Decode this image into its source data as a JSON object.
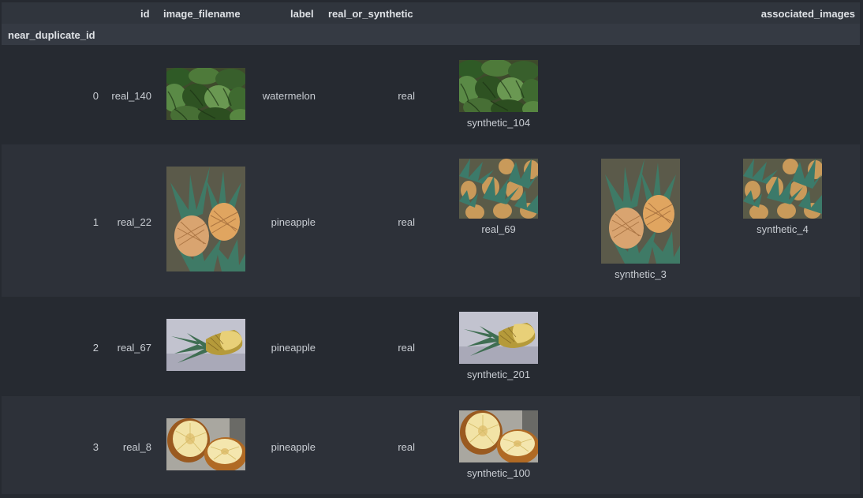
{
  "table": {
    "columns": [
      "id",
      "image_filename",
      "label",
      "real_or_synthetic",
      "associated_images"
    ],
    "index_name": "near_duplicate_id",
    "rows": [
      {
        "near_duplicate_id": "0",
        "id": "real_140",
        "image_icon": "watermelon-image",
        "label": "watermelon",
        "real_or_synthetic": "real",
        "associated": [
          {
            "caption": "synthetic_104",
            "icon": "watermelon-image"
          }
        ]
      },
      {
        "near_duplicate_id": "1",
        "id": "real_22",
        "image_icon": "pineapple-pile-image",
        "label": "pineapple",
        "real_or_synthetic": "real",
        "associated": [
          {
            "caption": "real_69",
            "icon": "pineapple-crowd-image"
          },
          {
            "caption": "synthetic_3",
            "icon": "pineapple-pile-image"
          },
          {
            "caption": "synthetic_4",
            "icon": "pineapple-crowd-image"
          }
        ]
      },
      {
        "near_duplicate_id": "2",
        "id": "real_67",
        "image_icon": "pineapple-half-image",
        "label": "pineapple",
        "real_or_synthetic": "real",
        "associated": [
          {
            "caption": "synthetic_201",
            "icon": "pineapple-half-image"
          }
        ]
      },
      {
        "near_duplicate_id": "3",
        "id": "real_8",
        "image_icon": "pineapple-cut-image",
        "label": "pineapple",
        "real_or_synthetic": "real",
        "associated": [
          {
            "caption": "synthetic_100",
            "icon": "pineapple-cut-image"
          }
        ]
      }
    ]
  }
}
